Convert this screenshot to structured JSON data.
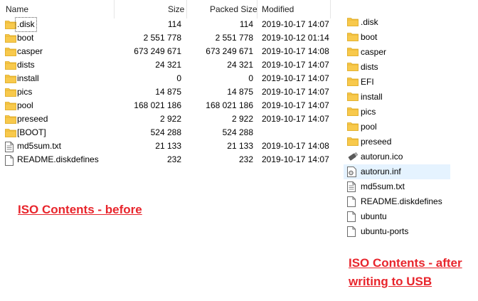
{
  "left": {
    "columns": {
      "name": "Name",
      "size": "Size",
      "packed": "Packed Size",
      "modified": "Modified"
    },
    "rows": [
      {
        "name": ".disk",
        "size": "114",
        "packed": "114",
        "modified": "2019-10-17 14:07",
        "type": "folder"
      },
      {
        "name": "boot",
        "size": "2 551 778",
        "packed": "2 551 778",
        "modified": "2019-10-12 01:14",
        "type": "folder"
      },
      {
        "name": "casper",
        "size": "673 249 671",
        "packed": "673 249 671",
        "modified": "2019-10-17 14:08",
        "type": "folder"
      },
      {
        "name": "dists",
        "size": "24 321",
        "packed": "24 321",
        "modified": "2019-10-17 14:07",
        "type": "folder"
      },
      {
        "name": "install",
        "size": "0",
        "packed": "0",
        "modified": "2019-10-17 14:07",
        "type": "folder"
      },
      {
        "name": "pics",
        "size": "14 875",
        "packed": "14 875",
        "modified": "2019-10-17 14:07",
        "type": "folder"
      },
      {
        "name": "pool",
        "size": "168 021 186",
        "packed": "168 021 186",
        "modified": "2019-10-17 14:07",
        "type": "folder"
      },
      {
        "name": "preseed",
        "size": "2 922",
        "packed": "2 922",
        "modified": "2019-10-17 14:07",
        "type": "folder"
      },
      {
        "name": "[BOOT]",
        "size": "524 288",
        "packed": "524 288",
        "modified": "",
        "type": "folder"
      },
      {
        "name": "md5sum.txt",
        "size": "21 133",
        "packed": "21 133",
        "modified": "2019-10-17 14:08",
        "type": "file-text"
      },
      {
        "name": "README.diskdefines",
        "size": "232",
        "packed": "232",
        "modified": "2019-10-17 14:07",
        "type": "file"
      }
    ],
    "caption": "ISO Contents - before"
  },
  "right": {
    "items": [
      {
        "name": ".disk",
        "type": "folder"
      },
      {
        "name": "boot",
        "type": "folder"
      },
      {
        "name": "casper",
        "type": "folder"
      },
      {
        "name": "dists",
        "type": "folder"
      },
      {
        "name": "EFI",
        "type": "folder"
      },
      {
        "name": "install",
        "type": "folder"
      },
      {
        "name": "pics",
        "type": "folder"
      },
      {
        "name": "pool",
        "type": "folder"
      },
      {
        "name": "preseed",
        "type": "folder"
      },
      {
        "name": "autorun.ico",
        "type": "usb-icon"
      },
      {
        "name": "autorun.inf",
        "type": "settings-file",
        "highlighted": true
      },
      {
        "name": "md5sum.txt",
        "type": "file-text"
      },
      {
        "name": "README.diskdefines",
        "type": "file"
      },
      {
        "name": "ubuntu",
        "type": "file"
      },
      {
        "name": "ubuntu-ports",
        "type": "file"
      }
    ],
    "caption_line1": "ISO Contents - after",
    "caption_line2": "writing to USB"
  },
  "colors": {
    "folder": "#f8c94c",
    "folder_dark": "#dca81f",
    "caption": "#e8252c",
    "highlight": "#e5f3ff"
  }
}
